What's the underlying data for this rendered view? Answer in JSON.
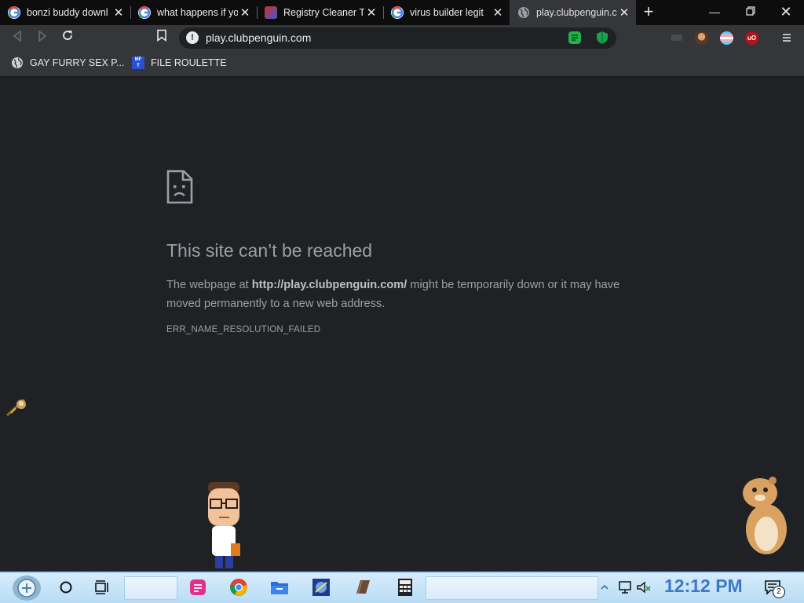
{
  "browser": {
    "tabs": [
      {
        "title": "bonzi buddy downl",
        "favicon": "google-icon",
        "active": false
      },
      {
        "title": "what happens if yo",
        "favicon": "google-icon",
        "active": false
      },
      {
        "title": "Registry Cleaner T",
        "favicon": "registry-cleaner-icon",
        "active": false
      },
      {
        "title": "virus builder legit",
        "favicon": "google-icon",
        "active": false
      },
      {
        "title": "play.clubpenguin.co",
        "favicon": "globe-icon",
        "active": true
      }
    ],
    "address": {
      "url": "play.clubpenguin.com"
    },
    "bookmarks": [
      {
        "label": "GAY FURRY SEX P...",
        "icon": "globe-icon"
      },
      {
        "label": "FILE ROULETTE",
        "icon": "mft-icon"
      }
    ]
  },
  "error_page": {
    "title": "This site can’t be reached",
    "desc_before": "The webpage at ",
    "desc_url": "http://play.clubpenguin.com/",
    "desc_after": " might be temporarily down or it may have moved permanently to a new web address.",
    "code": "ERR_NAME_RESOLUTION_FAILED"
  },
  "taskbar": {
    "clock": "12:12 PM",
    "notification_count": "2"
  },
  "colors": {
    "page_bg": "#202124",
    "toolbar_bg": "#35363a",
    "error_text": "#9aa0a6",
    "clock": "#3d78c9",
    "taskbar_bg": "#c8e4f8"
  }
}
